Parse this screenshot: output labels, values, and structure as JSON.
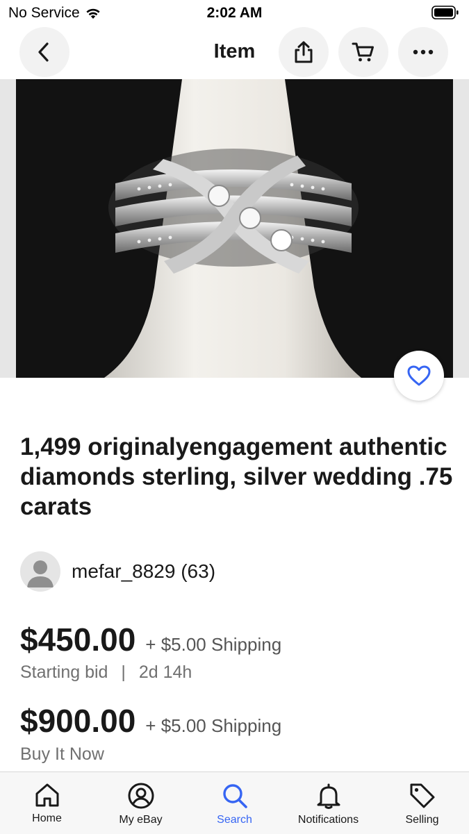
{
  "status_bar": {
    "carrier": "No Service",
    "time": "2:02 AM"
  },
  "nav": {
    "title": "Item",
    "icons": {
      "back": "chevron-left-icon",
      "share": "share-icon",
      "cart": "cart-icon",
      "more": "more-horizontal-icon"
    }
  },
  "listing": {
    "image_alt": "silver diamond ring on white ring display cone",
    "watch_icon": "heart-icon",
    "title": "1,499 originalyengagement authentic diamonds sterling, silver wedding .75 carats",
    "seller": {
      "name": "mefar_8829",
      "feedback": "(63)"
    },
    "auction": {
      "price": "$450.00",
      "shipping": "+ $5.00 Shipping",
      "label": "Starting bid",
      "separator": "|",
      "time_left": "2d 14h"
    },
    "buy_it_now": {
      "price": "$900.00",
      "shipping": "+ $5.00 Shipping",
      "label": "Buy It Now"
    }
  },
  "tab_bar": {
    "active": "Search",
    "accent_color": "#3665f3",
    "tabs": [
      {
        "label": "Home",
        "icon": "home-icon"
      },
      {
        "label": "My eBay",
        "icon": "user-circle-icon"
      },
      {
        "label": "Search",
        "icon": "search-icon"
      },
      {
        "label": "Notifications",
        "icon": "bell-icon"
      },
      {
        "label": "Selling",
        "icon": "tag-icon"
      }
    ]
  }
}
